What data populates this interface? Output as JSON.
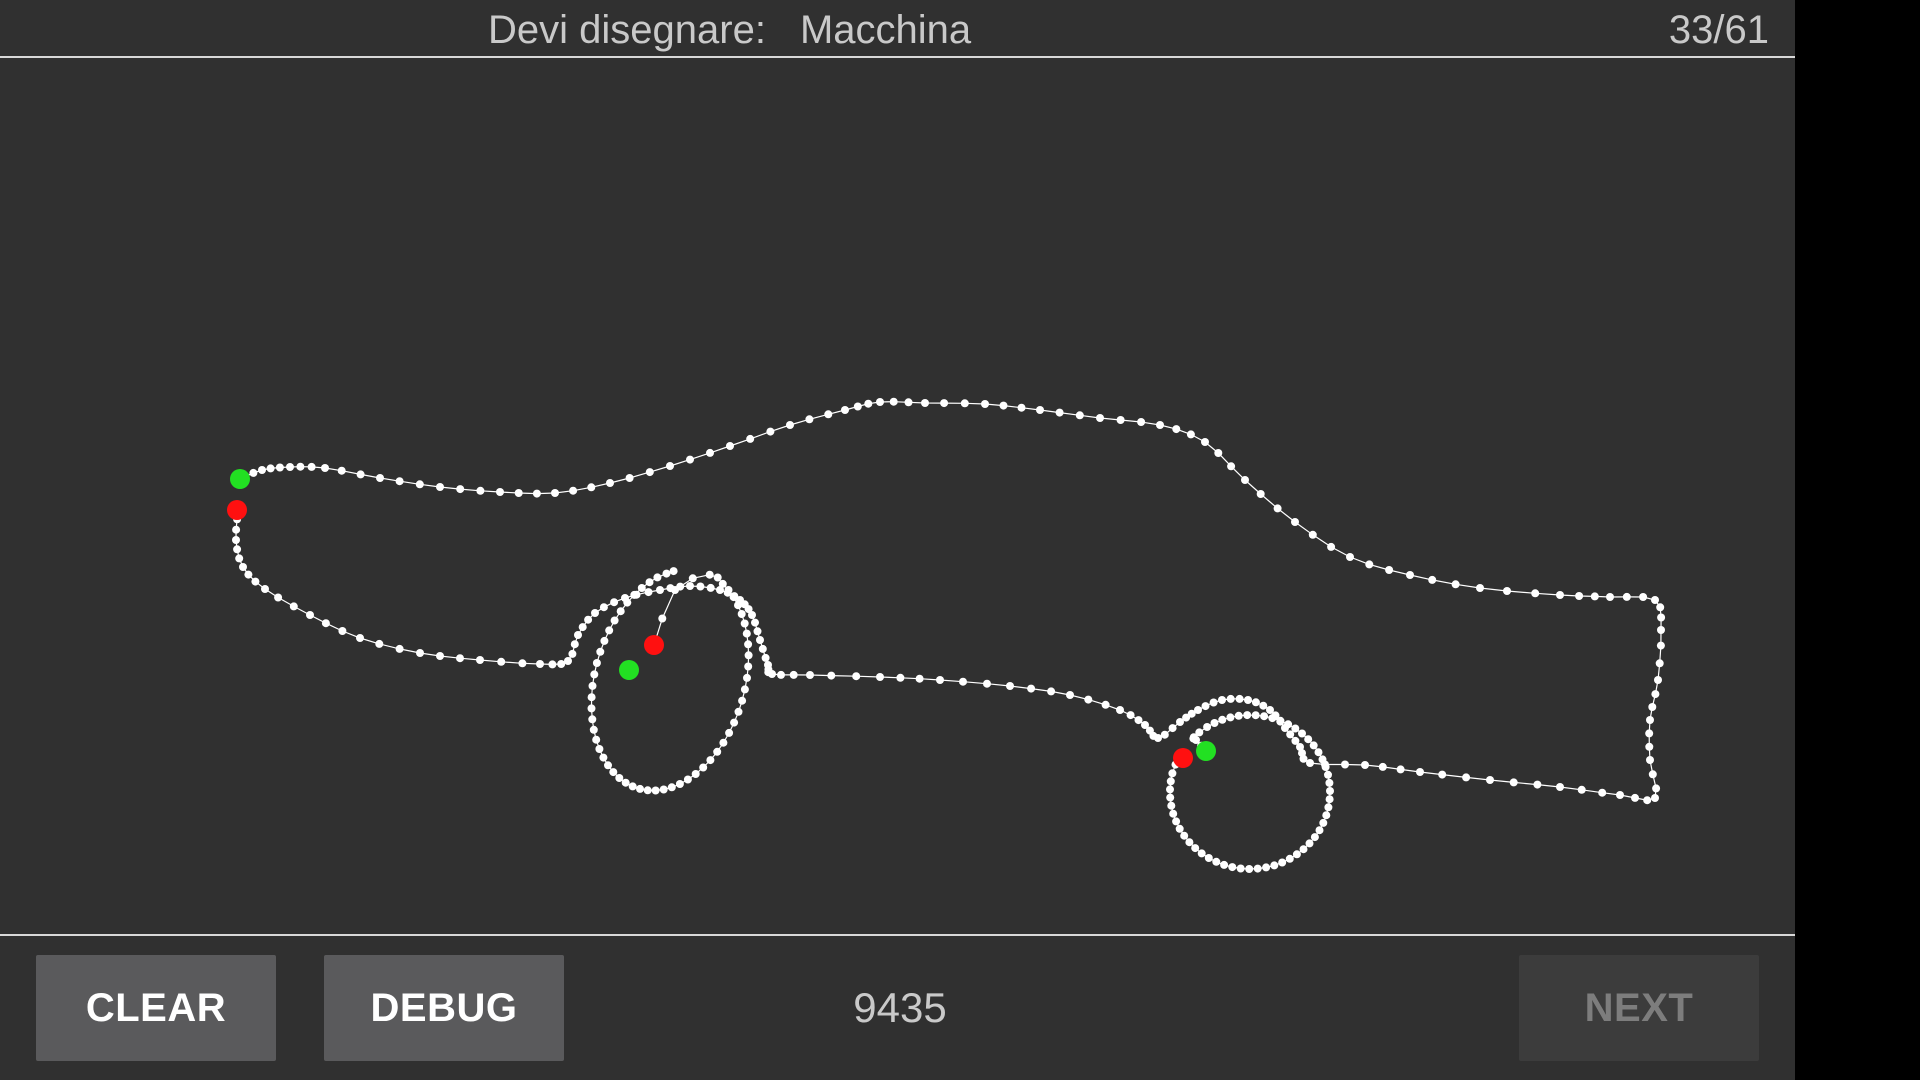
{
  "header": {
    "prompt_label": "Devi disegnare:",
    "target_word": "Macchina",
    "progress": "33/61"
  },
  "footer": {
    "clear_label": "CLEAR",
    "debug_label": "DEBUG",
    "score": "9435",
    "next_label": "NEXT"
  },
  "colors": {
    "background": "#303030",
    "stroke": "#ffffff",
    "stroke_start": "#22e022",
    "stroke_end": "#ff1010"
  },
  "icons": {
    "stroke_start_marker": "green-dot",
    "stroke_end_marker": "red-dot"
  }
}
